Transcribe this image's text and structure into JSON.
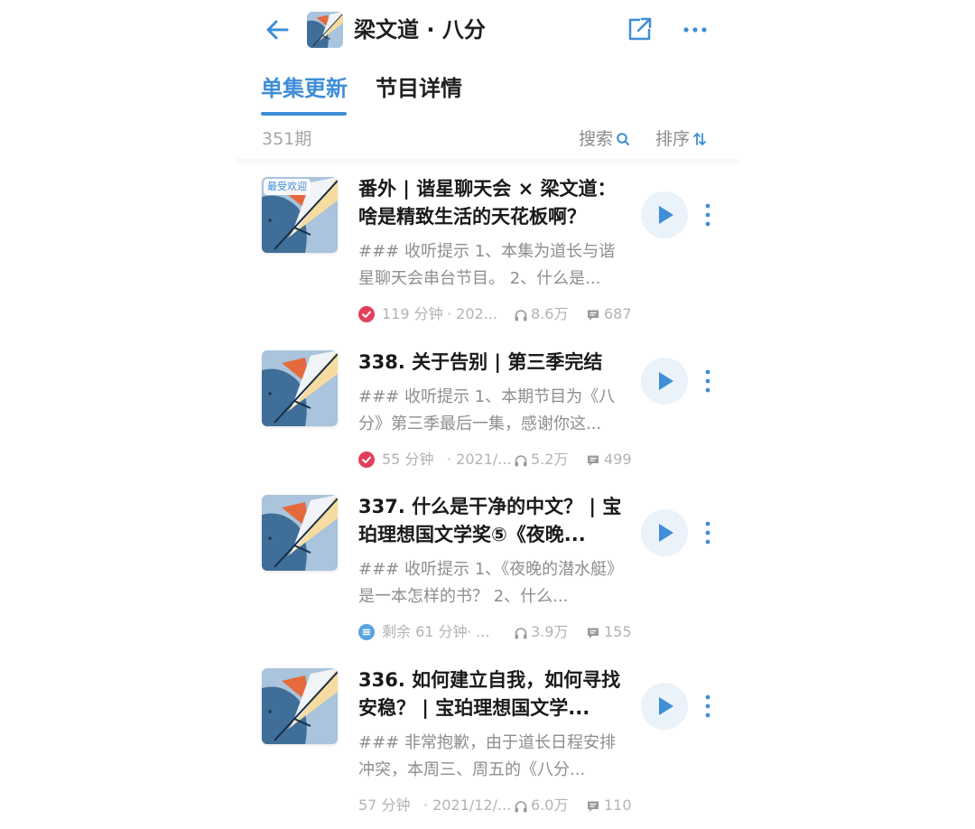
{
  "header": {
    "title": "梁文道 · 八分"
  },
  "tabs": [
    {
      "label": "单集更新",
      "active": true
    },
    {
      "label": "节目详情",
      "active": false
    }
  ],
  "toolbar": {
    "count": "351期",
    "search_label": "搜索",
    "sort_label": "排序"
  },
  "colors": {
    "accent": "#3f8ed6",
    "check_red": "#e2405a",
    "listening_blue": "#5aa2e0"
  },
  "episodes": [
    {
      "badge": "最受欢迎",
      "title": "番外 | 谐星聊天会 × 梁文道：啥是精致生活的天花板啊？",
      "description": "### 收听提示 1、本集为道长与谐星聊天会串台节目。 2、什么是...",
      "duration": "119 分钟",
      "date": "· 202...",
      "plays": "8.6万",
      "comments": "687",
      "status": "check-icon"
    },
    {
      "badge": "",
      "title": "338. 关于告别 | 第三季完结",
      "description": "### 收听提示 1、本期节目为《八分》第三季最后一集，感谢你这...",
      "duration": "55 分钟",
      "date": "· 2021/...",
      "plays": "5.2万",
      "comments": "499",
      "status": "check-icon"
    },
    {
      "badge": "",
      "title": "337. 什么是干净的中文？ | 宝珀理想国文学奖⑤《夜晚...",
      "description": "### 收听提示 1、《夜晚的潜水艇》是一本怎样的书？ 2、什么...",
      "duration": "剩余 61 分钟",
      "date": "· ...",
      "plays": "3.9万",
      "comments": "155",
      "status": "listening-icon"
    },
    {
      "badge": "",
      "title": "336. 如何建立自我，如何寻找安稳？ | 宝珀理想国文学...",
      "description": "### 非常抱歉，由于道长日程安排冲突，本周三、周五的《八分...",
      "duration": "57 分钟",
      "date": "· 2021/12/...",
      "plays": "6.0万",
      "comments": "110",
      "status": "none"
    }
  ]
}
